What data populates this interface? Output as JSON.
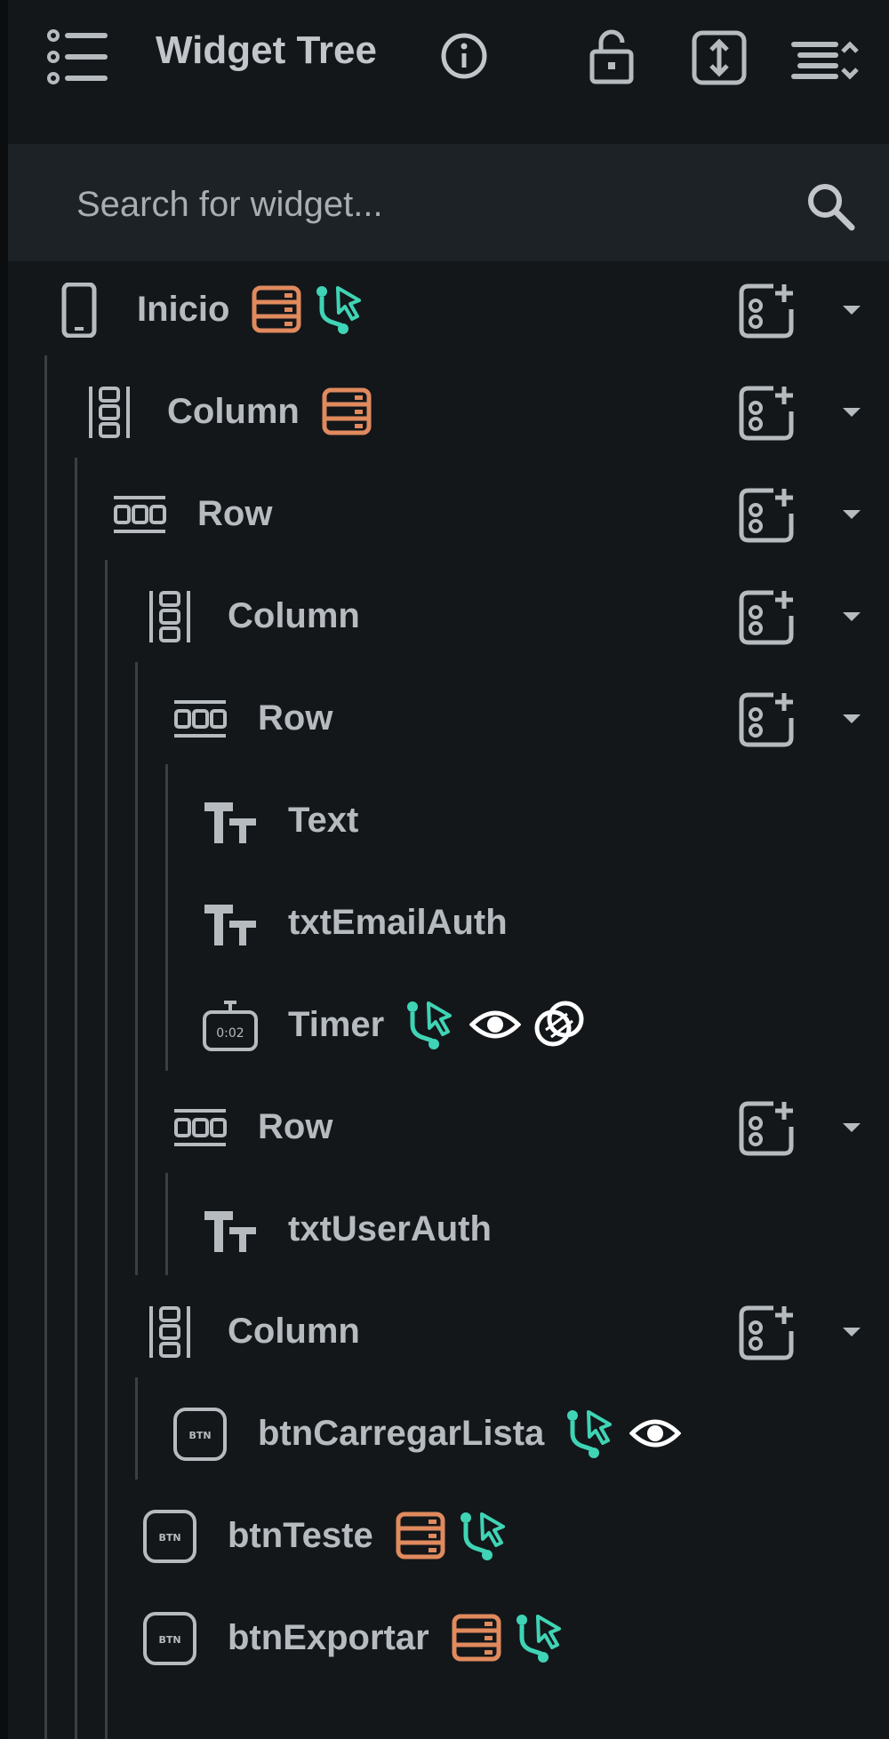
{
  "header": {
    "title": "Widget Tree",
    "icons": [
      "list-icon",
      "info-icon",
      "lock-icon",
      "expand-vertical-icon",
      "sort-icon"
    ]
  },
  "search": {
    "placeholder": "Search for widget...",
    "value": ""
  },
  "colors": {
    "background": "#13171a",
    "search_bg": "#1d2226",
    "text": "#b6bbbf",
    "backend_badge": "#e08a5e",
    "action_badge": "#3fd4b5",
    "visibility_badge": "#ffffff"
  },
  "tree": [
    {
      "label": "Inicio",
      "type": "page",
      "depth": 0,
      "badges": [
        "backend",
        "action"
      ],
      "expandable": true
    },
    {
      "label": "Column",
      "type": "column",
      "depth": 1,
      "badges": [
        "backend"
      ],
      "expandable": true
    },
    {
      "label": "Row",
      "type": "row",
      "depth": 2,
      "badges": [],
      "expandable": true
    },
    {
      "label": "Column",
      "type": "column",
      "depth": 3,
      "badges": [],
      "expandable": true
    },
    {
      "label": "Row",
      "type": "row",
      "depth": 4,
      "badges": [],
      "expandable": true
    },
    {
      "label": "Text",
      "type": "text",
      "depth": 5,
      "badges": [],
      "expandable": false
    },
    {
      "label": "txtEmailAuth",
      "type": "text",
      "depth": 5,
      "badges": [],
      "expandable": false
    },
    {
      "label": "Timer",
      "type": "timer",
      "depth": 5,
      "badges": [
        "action",
        "visibility",
        "link"
      ],
      "expandable": false
    },
    {
      "label": "Row",
      "type": "row",
      "depth": 4,
      "badges": [],
      "expandable": true
    },
    {
      "label": "txtUserAuth",
      "type": "text",
      "depth": 5,
      "badges": [],
      "expandable": false
    },
    {
      "label": "Column",
      "type": "column",
      "depth": 3,
      "badges": [],
      "expandable": true
    },
    {
      "label": "btnCarregarLista",
      "type": "button",
      "depth": 4,
      "badges": [
        "action",
        "visibility"
      ],
      "expandable": false
    },
    {
      "label": "btnTeste",
      "type": "button",
      "depth": 3,
      "badges": [
        "backend",
        "action"
      ],
      "expandable": false
    },
    {
      "label": "btnExportar",
      "type": "button",
      "depth": 3,
      "badges": [
        "backend",
        "action"
      ],
      "expandable": false
    }
  ],
  "timer_icon_text": "0:02",
  "button_icon_text": "BTN"
}
